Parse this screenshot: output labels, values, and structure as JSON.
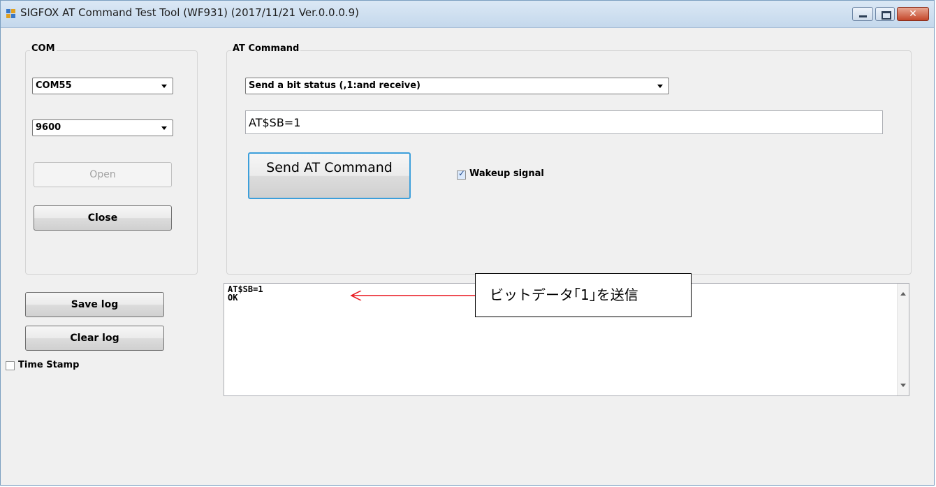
{
  "window": {
    "title": "SIGFOX AT Command Test Tool  (WF931) (2017/11/21 Ver.0.0.0.9)",
    "controls": {
      "close_glyph": "✕"
    }
  },
  "com": {
    "group_label": "COM",
    "port_selected": "COM55",
    "baud_selected": "9600",
    "open_label": "Open",
    "close_label": "Close"
  },
  "at": {
    "group_label": "AT Command",
    "command_selected": "Send a bit status (,1:and receive)",
    "command_text": "AT$SB=1",
    "send_label": "Send AT Command",
    "wakeup_label": "Wakeup signal",
    "wakeup_checked": true
  },
  "log_controls": {
    "save_label": "Save log",
    "clear_label": "Clear log",
    "timestamp_label": "Time Stamp",
    "timestamp_checked": false
  },
  "log": {
    "text": "AT$SB=1\nOK"
  },
  "annotation": {
    "text": "ビットデータ｢1｣を送信",
    "arrow_color": "#e8141b"
  },
  "colors": {
    "focus_border": "#3c9fdb",
    "titlebar": "#c4d8ec",
    "close_button": "#c4472a"
  }
}
